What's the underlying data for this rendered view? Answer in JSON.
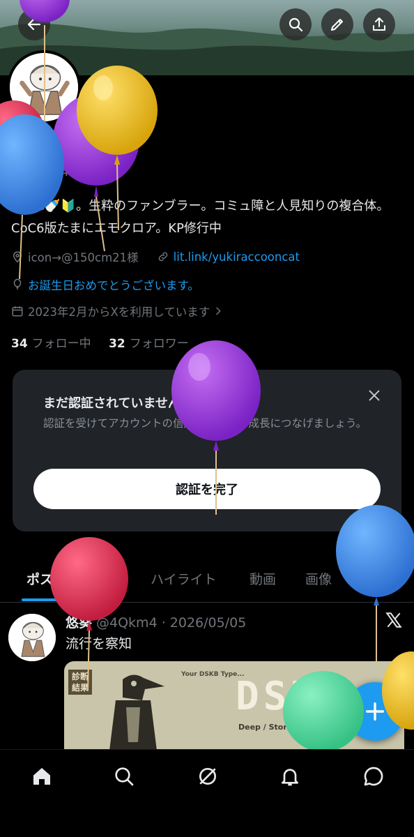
{
  "header": {
    "back_icon": "arrow-left-icon",
    "search_icon": "search-icon",
    "edit_icon": "pencil-icon",
    "share_icon": "share-icon"
  },
  "profile": {
    "name": "悠葵",
    "handle": "@4Qkm4",
    "bio": "TRPG🍼🔰。生粋のファンブラー。コミュ障と人見知りの複合体。CoC6版たまにエモクロア。KP修行中",
    "location": "icon→@150cm21様",
    "website": "lit.link/yukiraccooncat",
    "birthday": "お誕生日おめでとうございます。",
    "joined": "2023年2月からXを利用しています",
    "following_count": "34",
    "following_label": "フォロー中",
    "followers_count": "32",
    "followers_label": "フォロワー"
  },
  "verify_card": {
    "title": "まだ認証されていません",
    "text": "認証を受けてアカウントの信用度を高め、成長につなげましょう。",
    "button": "認証を完了"
  },
  "tabs": [
    {
      "label": "ポスト"
    },
    {
      "label": "返信"
    },
    {
      "label": "ハイライト"
    },
    {
      "label": "動画"
    },
    {
      "label": "画像"
    },
    {
      "label": "記事"
    }
  ],
  "post": {
    "name": "悠葵",
    "meta": "@4Qkm4 · 2026/05/05",
    "text": "流行を察知",
    "media": {
      "label": "診断結果",
      "subtitle": "Your DSKB Type...",
      "big": "DSKB",
      "line": "Deep / Story / Kansho /"
    }
  },
  "colors": {
    "accent": "#1d9bf0",
    "background": "#000000",
    "card": "#202327",
    "muted": "#71767b"
  },
  "bottom_nav": [
    {
      "icon": "home-icon"
    },
    {
      "icon": "search-icon"
    },
    {
      "icon": "grok-icon"
    },
    {
      "icon": "bell-icon"
    },
    {
      "icon": "messages-icon"
    }
  ]
}
